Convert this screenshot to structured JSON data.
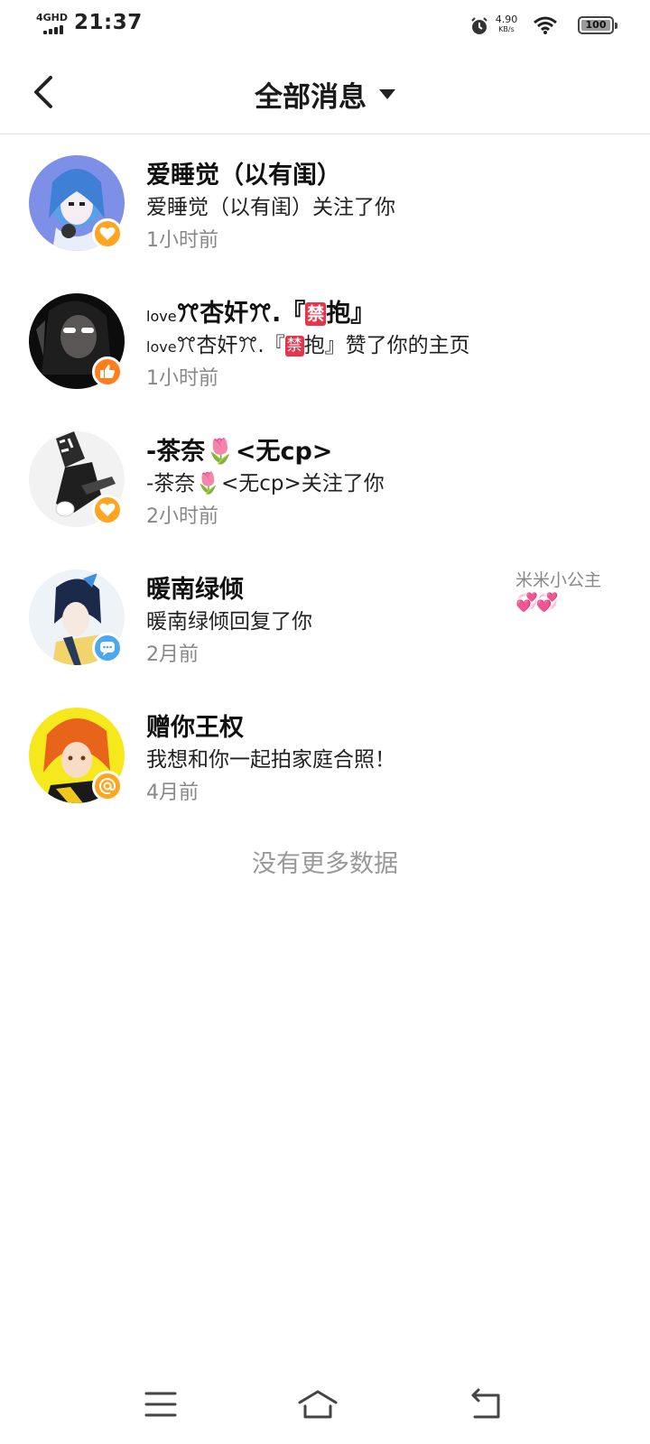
{
  "status_bar": {
    "network": "4GHD",
    "time": "21:37",
    "speed_value": "4.90",
    "speed_unit": "KB/s",
    "battery": "100"
  },
  "header": {
    "title": "全部消息"
  },
  "messages": [
    {
      "name": "爱睡觉（以有闺）",
      "text": "爱睡觉（以有闺）关注了你",
      "time": "1小时前",
      "badge": "heart-icon",
      "badge_color": "#ffa51f"
    },
    {
      "name_prefix": "love",
      "name_mid": "ꔫ杏奸ꔫ.『",
      "ban_label": "禁",
      "name_suffix": "抱』",
      "text_suffix": "抱』赞了你的主页",
      "time": "1小时前",
      "badge": "thumbs-up-icon",
      "badge_color": "#ff7d1a"
    },
    {
      "name_prefix": "-茶奈",
      "emoji": "🌷",
      "name_suffix": "<无cp>",
      "text_suffix": "<无cp>关注了你",
      "time": "2小时前",
      "badge": "heart-icon",
      "badge_color": "#ffa51f"
    },
    {
      "name": "暖南绿倾",
      "text": "暖南绿倾回复了你",
      "time": "2月前",
      "badge": "comment-icon",
      "badge_color": "#4aa8f0",
      "side_tag": "米米小公主",
      "side_hearts": "💞💞"
    },
    {
      "name": "赠你王权",
      "text": "我想和你一起拍家庭合照！",
      "time": "4月前",
      "badge": "at-icon",
      "badge_color": "#ffa51f"
    }
  ],
  "footer": {
    "no_more": "没有更多数据"
  },
  "nav_bar": {
    "menu_icon": "menu-icon",
    "home_icon": "home-icon",
    "back_icon": "back-icon"
  }
}
